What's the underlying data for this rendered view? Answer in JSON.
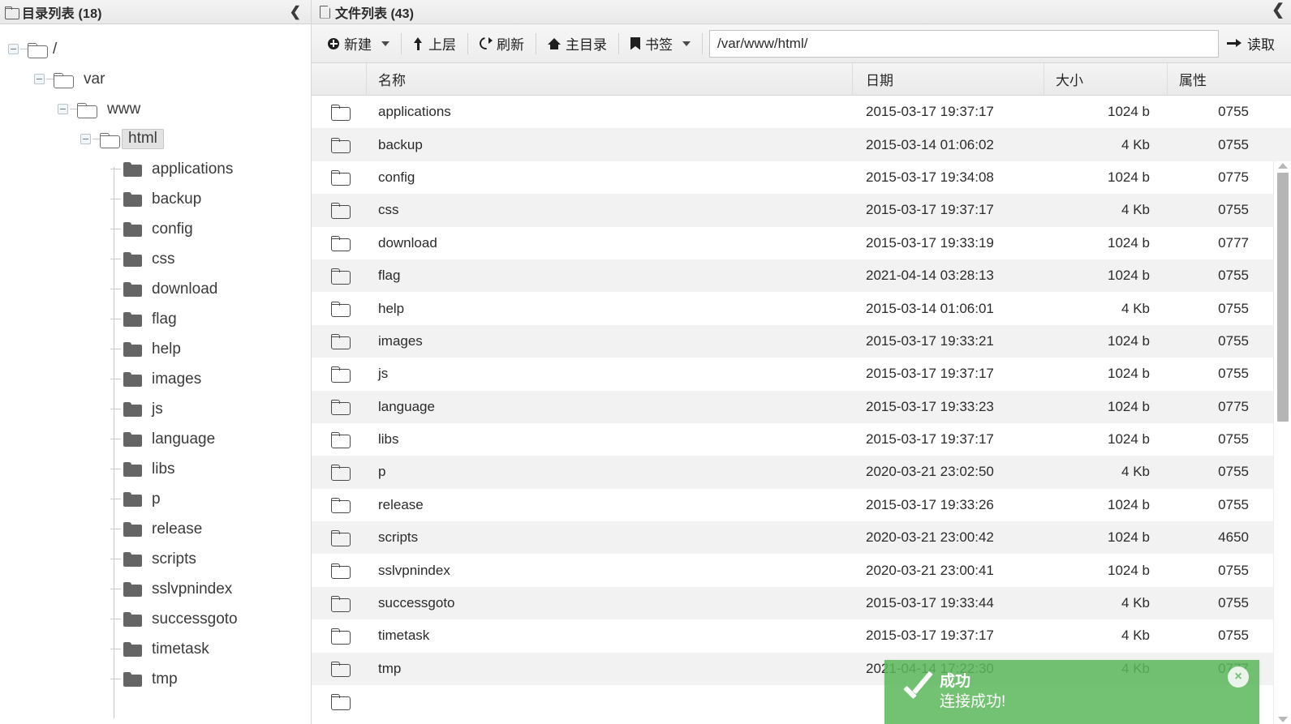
{
  "left_panel": {
    "title": "目录列表 (18)",
    "collapse_icon": "chevron-left-icon",
    "tree": {
      "root": "/",
      "level1": "var",
      "level2": "www",
      "level3": "html",
      "children": [
        "applications",
        "backup",
        "config",
        "css",
        "download",
        "flag",
        "help",
        "images",
        "js",
        "language",
        "libs",
        "p",
        "release",
        "scripts",
        "sslvpnindex",
        "successgoto",
        "timetask",
        "tmp"
      ]
    }
  },
  "right_panel": {
    "title": "文件列表 (43)",
    "collapse_icon": "chevron-up-icon",
    "toolbar": {
      "new_label": "新建",
      "up_label": "上层",
      "refresh_label": "刷新",
      "home_label": "主目录",
      "bookmark_label": "书签",
      "read_label": "读取",
      "path_value": "/var/www/html/",
      "path_placeholder": "/var/www/html/"
    },
    "table": {
      "columns": [
        "名称",
        "日期",
        "大小",
        "属性"
      ],
      "rows": [
        {
          "name": "applications",
          "date": "2015-03-17 19:37:17",
          "size": "1024 b",
          "attr": "0755"
        },
        {
          "name": "backup",
          "date": "2015-03-14 01:06:02",
          "size": "4 Kb",
          "attr": "0755"
        },
        {
          "name": "config",
          "date": "2015-03-17 19:34:08",
          "size": "1024 b",
          "attr": "0775"
        },
        {
          "name": "css",
          "date": "2015-03-17 19:37:17",
          "size": "4 Kb",
          "attr": "0755"
        },
        {
          "name": "download",
          "date": "2015-03-17 19:33:19",
          "size": "1024 b",
          "attr": "0777"
        },
        {
          "name": "flag",
          "date": "2021-04-14 03:28:13",
          "size": "1024 b",
          "attr": "0755"
        },
        {
          "name": "help",
          "date": "2015-03-14 01:06:01",
          "size": "4 Kb",
          "attr": "0755"
        },
        {
          "name": "images",
          "date": "2015-03-17 19:33:21",
          "size": "1024 b",
          "attr": "0755"
        },
        {
          "name": "js",
          "date": "2015-03-17 19:37:17",
          "size": "1024 b",
          "attr": "0755"
        },
        {
          "name": "language",
          "date": "2015-03-17 19:33:23",
          "size": "1024 b",
          "attr": "0775"
        },
        {
          "name": "libs",
          "date": "2015-03-17 19:37:17",
          "size": "1024 b",
          "attr": "0755"
        },
        {
          "name": "p",
          "date": "2020-03-21 23:02:50",
          "size": "4 Kb",
          "attr": "0755"
        },
        {
          "name": "release",
          "date": "2015-03-17 19:33:26",
          "size": "1024 b",
          "attr": "0755"
        },
        {
          "name": "scripts",
          "date": "2020-03-21 23:00:42",
          "size": "1024 b",
          "attr": "4650"
        },
        {
          "name": "sslvpnindex",
          "date": "2020-03-21 23:00:41",
          "size": "1024 b",
          "attr": "0755"
        },
        {
          "name": "successgoto",
          "date": "2015-03-17 19:33:44",
          "size": "4 Kb",
          "attr": "0755"
        },
        {
          "name": "timetask",
          "date": "2015-03-17 19:37:17",
          "size": "4 Kb",
          "attr": "0755"
        },
        {
          "name": "tmp",
          "date": "2021-04-14 17:22:30",
          "size": "4 Kb",
          "attr": "0777"
        }
      ]
    }
  },
  "toast": {
    "title": "成功",
    "message": "连接成功!",
    "close_icon": "close-icon",
    "color": "#5cb85c"
  }
}
